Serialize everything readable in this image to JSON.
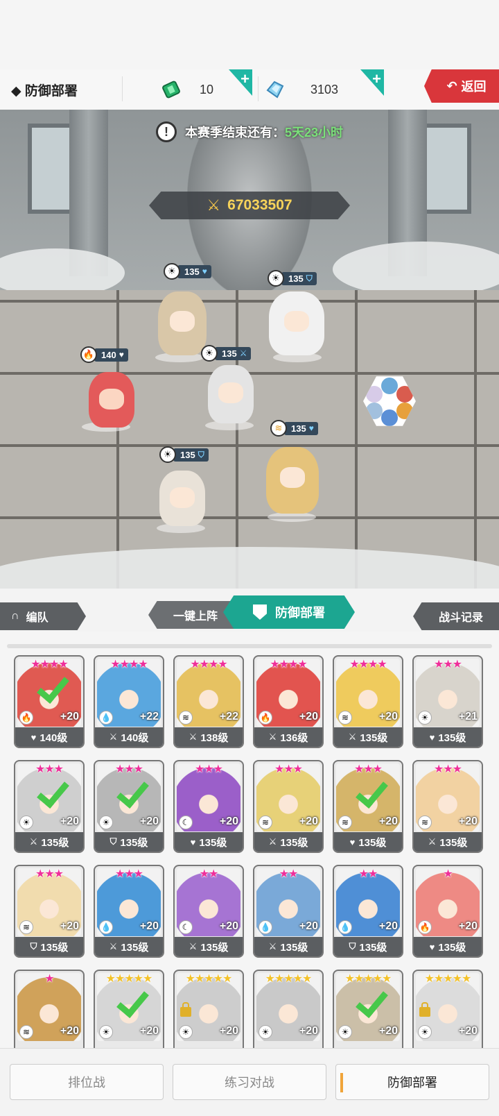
{
  "header": {
    "title": "◆ 防御部署",
    "tickets": "10",
    "gems": "3103",
    "back_label": "返回"
  },
  "scene": {
    "season_label": "本赛季结束还有：",
    "season_time": "5天23小时",
    "power": "67033507",
    "units": [
      {
        "level": "135",
        "elem": "sun-icon",
        "role": "heart"
      },
      {
        "level": "135",
        "elem": "sun-icon",
        "role": "shield"
      },
      {
        "level": "140",
        "elem": "fire-icon",
        "role": "heart"
      },
      {
        "level": "135",
        "elem": "sun-icon",
        "role": "sword"
      },
      {
        "level": "135",
        "elem": "wind-icon",
        "role": "heart"
      },
      {
        "level": "135",
        "elem": "sun-icon",
        "role": "shield"
      }
    ]
  },
  "tabs": {
    "team": "编队",
    "auto_deploy": "一键上阵",
    "defense": "防御部署",
    "battle_log": "战斗记录"
  },
  "roster": [
    {
      "stars": "★★★★",
      "gold": false,
      "plus": "+20",
      "elem": "fire",
      "role": "♥",
      "level": "140级",
      "checked": true,
      "color": "#e05a52"
    },
    {
      "stars": "★★★★",
      "gold": false,
      "plus": "+22",
      "elem": "water",
      "role": "⚔",
      "level": "140级",
      "checked": false,
      "color": "#5aa7df"
    },
    {
      "stars": "★★★★",
      "gold": false,
      "plus": "+22",
      "elem": "wind",
      "role": "⚔",
      "level": "138级",
      "checked": false,
      "color": "#e6c262"
    },
    {
      "stars": "★★★★",
      "gold": false,
      "plus": "+20",
      "elem": "fire",
      "role": "⚔",
      "level": "136级",
      "checked": false,
      "color": "#e2544f"
    },
    {
      "stars": "★★★★",
      "gold": false,
      "plus": "+20",
      "elem": "wind",
      "role": "⚔",
      "level": "135级",
      "checked": false,
      "color": "#efcb5d"
    },
    {
      "stars": "★★★",
      "gold": false,
      "plus": "+21",
      "elem": "sun",
      "role": "♥",
      "level": "135级",
      "checked": false,
      "color": "#d8d4cc"
    },
    {
      "stars": "★★★",
      "gold": false,
      "plus": "+20",
      "elem": "sun",
      "role": "⚔",
      "level": "135级",
      "checked": true,
      "color": "#cfcfcf"
    },
    {
      "stars": "★★★",
      "gold": false,
      "plus": "+20",
      "elem": "sun",
      "role": "⛉",
      "level": "135级",
      "checked": true,
      "color": "#b7b7b7"
    },
    {
      "stars": "★★★",
      "gold": false,
      "plus": "+20",
      "elem": "moon",
      "role": "♥",
      "level": "135级",
      "checked": false,
      "color": "#9b5fc9"
    },
    {
      "stars": "★★★",
      "gold": false,
      "plus": "+20",
      "elem": "wind",
      "role": "⚔",
      "level": "135级",
      "checked": false,
      "color": "#e7d178"
    },
    {
      "stars": "★★★",
      "gold": false,
      "plus": "+20",
      "elem": "wind",
      "role": "♥",
      "level": "135级",
      "checked": true,
      "color": "#d5b56a"
    },
    {
      "stars": "★★★",
      "gold": false,
      "plus": "+20",
      "elem": "wind",
      "role": "⚔",
      "level": "135级",
      "checked": false,
      "color": "#f2d2a2"
    },
    {
      "stars": "★★★",
      "gold": false,
      "plus": "+20",
      "elem": "wind",
      "role": "⛉",
      "level": "135级",
      "checked": false,
      "color": "#f1dcae"
    },
    {
      "stars": "★★★",
      "gold": false,
      "plus": "+20",
      "elem": "water",
      "role": "⚔",
      "level": "135级",
      "checked": false,
      "color": "#4d9ad9"
    },
    {
      "stars": "★★",
      "gold": false,
      "plus": "+20",
      "elem": "moon",
      "role": "⚔",
      "level": "135级",
      "checked": false,
      "color": "#a674d3"
    },
    {
      "stars": "★★",
      "gold": false,
      "plus": "+20",
      "elem": "water",
      "role": "⚔",
      "level": "135级",
      "checked": false,
      "color": "#7aa9d8"
    },
    {
      "stars": "★★",
      "gold": false,
      "plus": "+20",
      "elem": "water",
      "role": "⛉",
      "level": "135级",
      "checked": false,
      "color": "#4f8fd6"
    },
    {
      "stars": "★",
      "gold": false,
      "plus": "+20",
      "elem": "fire",
      "role": "♥",
      "level": "135级",
      "checked": false,
      "color": "#ee8a84"
    },
    {
      "stars": "★",
      "gold": false,
      "plus": "+20",
      "elem": "wind",
      "role": "",
      "level": "",
      "checked": false,
      "color": "#d0a25a"
    },
    {
      "stars": "★★★★★",
      "gold": true,
      "plus": "+20",
      "elem": "sun",
      "role": "",
      "level": "",
      "checked": true,
      "color": "#d6d6d6"
    },
    {
      "stars": "★★★★★",
      "gold": true,
      "plus": "+20",
      "elem": "sun",
      "role": "",
      "level": "",
      "checked": false,
      "locked": true,
      "color": "#cdcdcd"
    },
    {
      "stars": "★★★★★",
      "gold": true,
      "plus": "+20",
      "elem": "sun",
      "role": "",
      "level": "",
      "checked": false,
      "color": "#c9c9c9"
    },
    {
      "stars": "★★★★★",
      "gold": true,
      "plus": "+20",
      "elem": "sun",
      "role": "",
      "level": "",
      "checked": true,
      "color": "#cbbfa8"
    },
    {
      "stars": "★★★★★",
      "gold": true,
      "plus": "+20",
      "elem": "sun",
      "role": "",
      "level": "",
      "checked": false,
      "locked": true,
      "color": "#dcdcdc"
    }
  ],
  "bottom_nav": {
    "ranked": "排位战",
    "practice": "练习对战",
    "defense": "防御部署"
  },
  "colors": {
    "accent": "#1ca691",
    "back": "#d9363b",
    "star_pink": "#ef2f9a",
    "star_gold": "#f3c22a",
    "check": "#47c84a"
  }
}
